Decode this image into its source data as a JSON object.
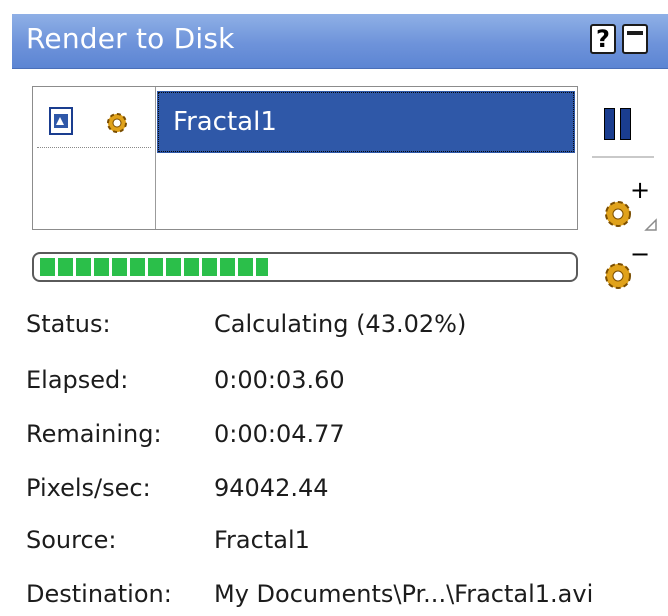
{
  "window": {
    "title": "Render to Disk",
    "help_glyph": "?"
  },
  "queue": {
    "items": [
      {
        "label": "Fractal1",
        "selected": true
      }
    ]
  },
  "buttons": {
    "pause": "pause-icon",
    "add_job": "add-render-job-icon",
    "remove_job": "remove-render-job-icon",
    "add_glyph": "+",
    "remove_glyph": "−"
  },
  "progress": {
    "fraction": 0.4302,
    "fill_color": "#2bbf4a"
  },
  "details": [
    {
      "label": "Status:",
      "value": "Calculating (43.02%)"
    },
    {
      "label": "Elapsed:",
      "value": "0:00:03.60"
    },
    {
      "label": "Remaining:",
      "value": "0:00:04.77"
    },
    {
      "label": "Pixels/sec:",
      "value": "94042.44"
    },
    {
      "label": "Source:",
      "value": "Fractal1"
    },
    {
      "label": "Destination:",
      "value": "My Documents\\Pr...\\Fractal1.avi"
    }
  ],
  "colors": {
    "title_bar": "#6e93da",
    "selection": "#2f58a8",
    "gear": "#e0a21b"
  }
}
